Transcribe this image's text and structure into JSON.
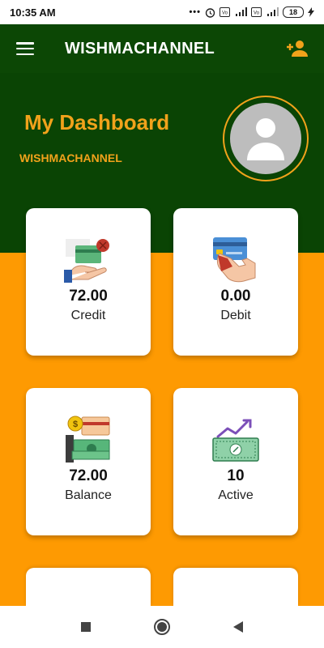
{
  "status_bar": {
    "time": "10:35 AM",
    "dots": "•••",
    "battery": "18",
    "icons": [
      "alarm-icon",
      "volte-icon",
      "signal-4g-icon",
      "volte-icon",
      "signal-icon",
      "battery-icon",
      "charging-icon"
    ]
  },
  "app_bar": {
    "title": "WISHMACHANNEL",
    "icons": [
      "menu-icon",
      "add-user-icon"
    ],
    "accent_color": "#f1a21b"
  },
  "header": {
    "title": "My Dashboard",
    "username": "WISHMACHANNEL",
    "background": "#0a4404"
  },
  "cards": [
    {
      "value": "72.00",
      "label": "Credit",
      "icon": "credit-hand-card-icon"
    },
    {
      "value": "0.00",
      "label": "Debit",
      "icon": "debit-card-hand-icon"
    },
    {
      "value": "72.00",
      "label": "Balance",
      "icon": "balance-money-icon"
    },
    {
      "value": "10",
      "label": "Active",
      "icon": "active-banknote-chart-icon"
    }
  ],
  "body_color": "#fe9a02",
  "nav_bar": {
    "icons": [
      "recents-square-icon",
      "home-circle-icon",
      "back-triangle-icon"
    ]
  }
}
